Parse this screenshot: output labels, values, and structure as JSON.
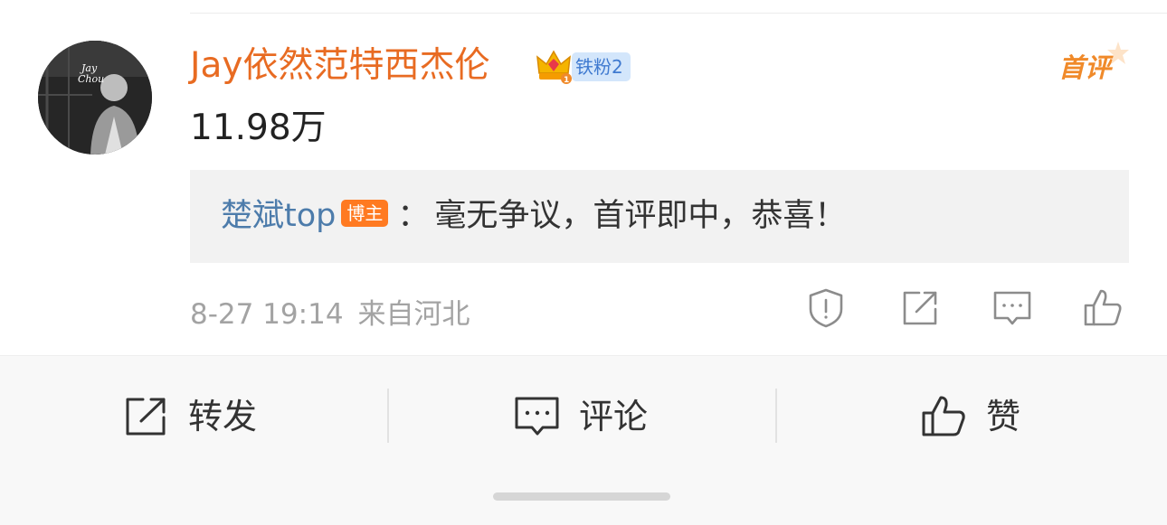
{
  "comment": {
    "username": "Jay依然范特西杰伦",
    "fan_badge": "铁粉2",
    "first_comment_badge": "首评",
    "text": "11.98万",
    "reply": {
      "author": "楚斌top",
      "author_badge": "博主",
      "separator": "：",
      "text": "毫无争议，首评即中，恭喜！"
    },
    "date": "8-27 19:14",
    "location": "来自河北"
  },
  "actions": {
    "report_icon": "shield-exclamation-icon",
    "repost_icon": "share-arrow-icon",
    "comment_icon": "comment-bubble-icon",
    "like_icon": "thumbs-up-icon"
  },
  "bottom_bar": {
    "repost_label": "转发",
    "comment_label": "评论",
    "like_label": "赞"
  },
  "colors": {
    "username": "#e86b22",
    "reply_author": "#4d7cab",
    "fan_badge_bg": "#d3e6fb",
    "blogger_badge_bg": "#ff7a21",
    "first_comment": "#f08a2a"
  }
}
